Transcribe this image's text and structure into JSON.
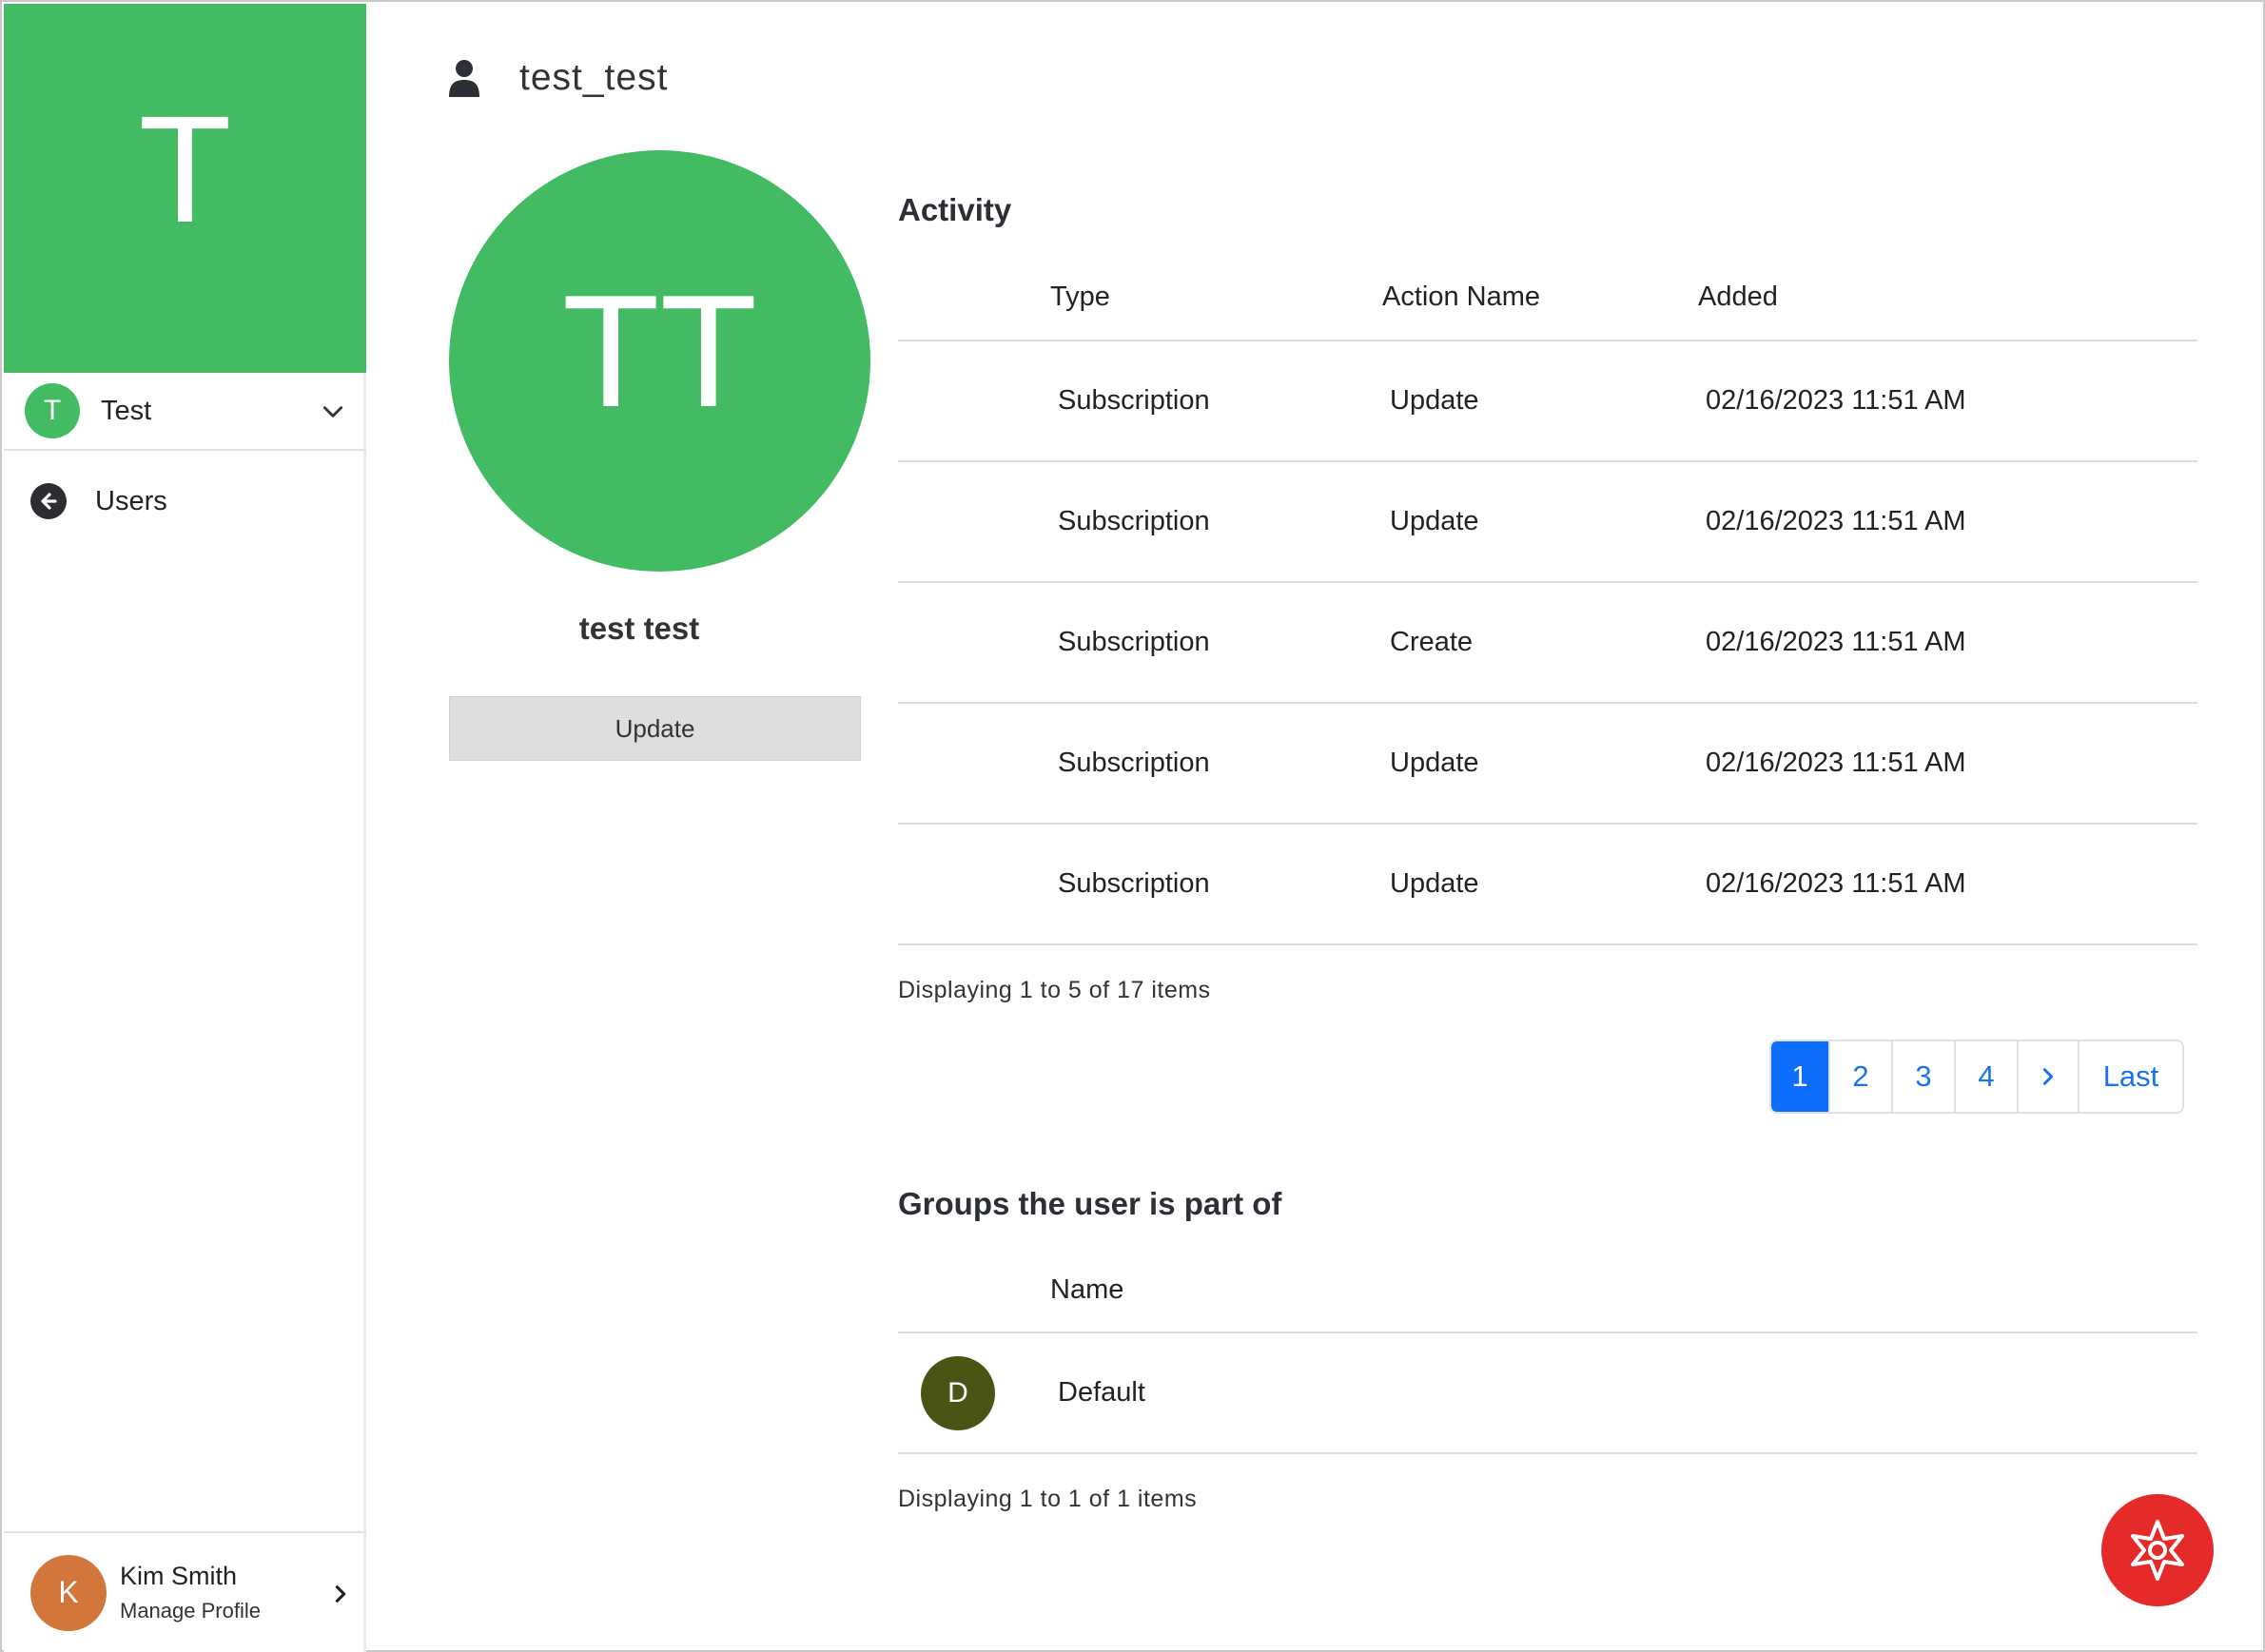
{
  "sidebar": {
    "org_initial": "T",
    "org_badge_initial": "T",
    "org_name": "Test",
    "back_link_label": "Users",
    "profile": {
      "initial": "K",
      "name": "Kim Smith",
      "subtitle": "Manage Profile"
    }
  },
  "header": {
    "title": "test_test"
  },
  "user": {
    "initials": "TT",
    "full_name": "test test",
    "update_label": "Update"
  },
  "activity": {
    "title": "Activity",
    "columns": [
      "Type",
      "Action Name",
      "Added"
    ],
    "rows": [
      {
        "type": "Subscription",
        "action": "Update",
        "added": "02/16/2023 11:51 AM"
      },
      {
        "type": "Subscription",
        "action": "Update",
        "added": "02/16/2023 11:51 AM"
      },
      {
        "type": "Subscription",
        "action": "Create",
        "added": "02/16/2023 11:51 AM"
      },
      {
        "type": "Subscription",
        "action": "Update",
        "added": "02/16/2023 11:51 AM"
      },
      {
        "type": "Subscription",
        "action": "Update",
        "added": "02/16/2023 11:51 AM"
      }
    ],
    "summary": "Displaying 1 to 5 of 17 items",
    "pagination": {
      "pages": [
        "1",
        "2",
        "3",
        "4"
      ],
      "active_page": "1",
      "last_label": "Last"
    }
  },
  "groups": {
    "title": "Groups the user is part of",
    "columns": [
      "Name"
    ],
    "rows": [
      {
        "initial": "D",
        "name": "Default"
      }
    ],
    "summary": "Displaying 1 to 1 of 1 items"
  },
  "colors": {
    "brand_green": "#42bb62",
    "accent_blue": "#0d6efd",
    "link_blue": "#1a73e8",
    "profile_orange": "#d2763c",
    "group_olive": "#4b5315",
    "fab_red": "#e52a2a"
  },
  "icons": {
    "header": "user-icon",
    "back": "arrow-left-circle-icon",
    "org_dropdown": "chevron-down-icon",
    "profile_more": "chevron-right-icon",
    "pager_next": "chevron-right-icon",
    "fab": "help-burst-icon"
  }
}
